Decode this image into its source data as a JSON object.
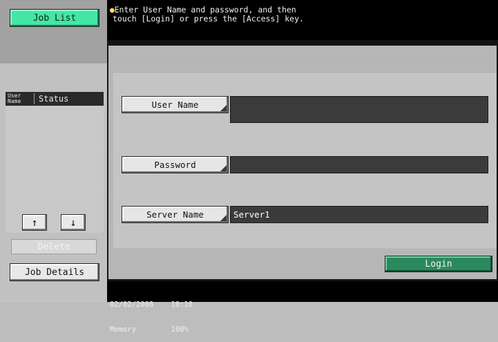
{
  "left_panel": {
    "job_list_label": "Job List",
    "column_user": "User Name",
    "column_user_line1": "User",
    "column_user_line2": "Name",
    "column_status": "Status",
    "up_arrow": "↑",
    "down_arrow": "↓",
    "delete_label": "Delete",
    "job_details_label": "Job Details"
  },
  "message": {
    "line1": "Enter User Name and password, and then",
    "line2": "touch [Login] or press the [Access] key."
  },
  "form": {
    "user_name_label": "User Name",
    "user_name_value": "",
    "password_label": "Password",
    "password_value": "",
    "server_name_label": "Server Name",
    "server_name_value": "Server1",
    "login_label": "Login"
  },
  "status_bar": {
    "date": "02/02/2008",
    "time": "10:10",
    "memory_label": "Memory",
    "memory_value": "100%"
  },
  "colors": {
    "job_list_button": "#43e6a5",
    "login_button": "#2a8a5e",
    "message_bar": "#000000",
    "input_field": "#3b3b3b"
  },
  "icons": {
    "message": "lightbulb-icon",
    "up": "arrow-up-icon",
    "down": "arrow-down-icon"
  }
}
